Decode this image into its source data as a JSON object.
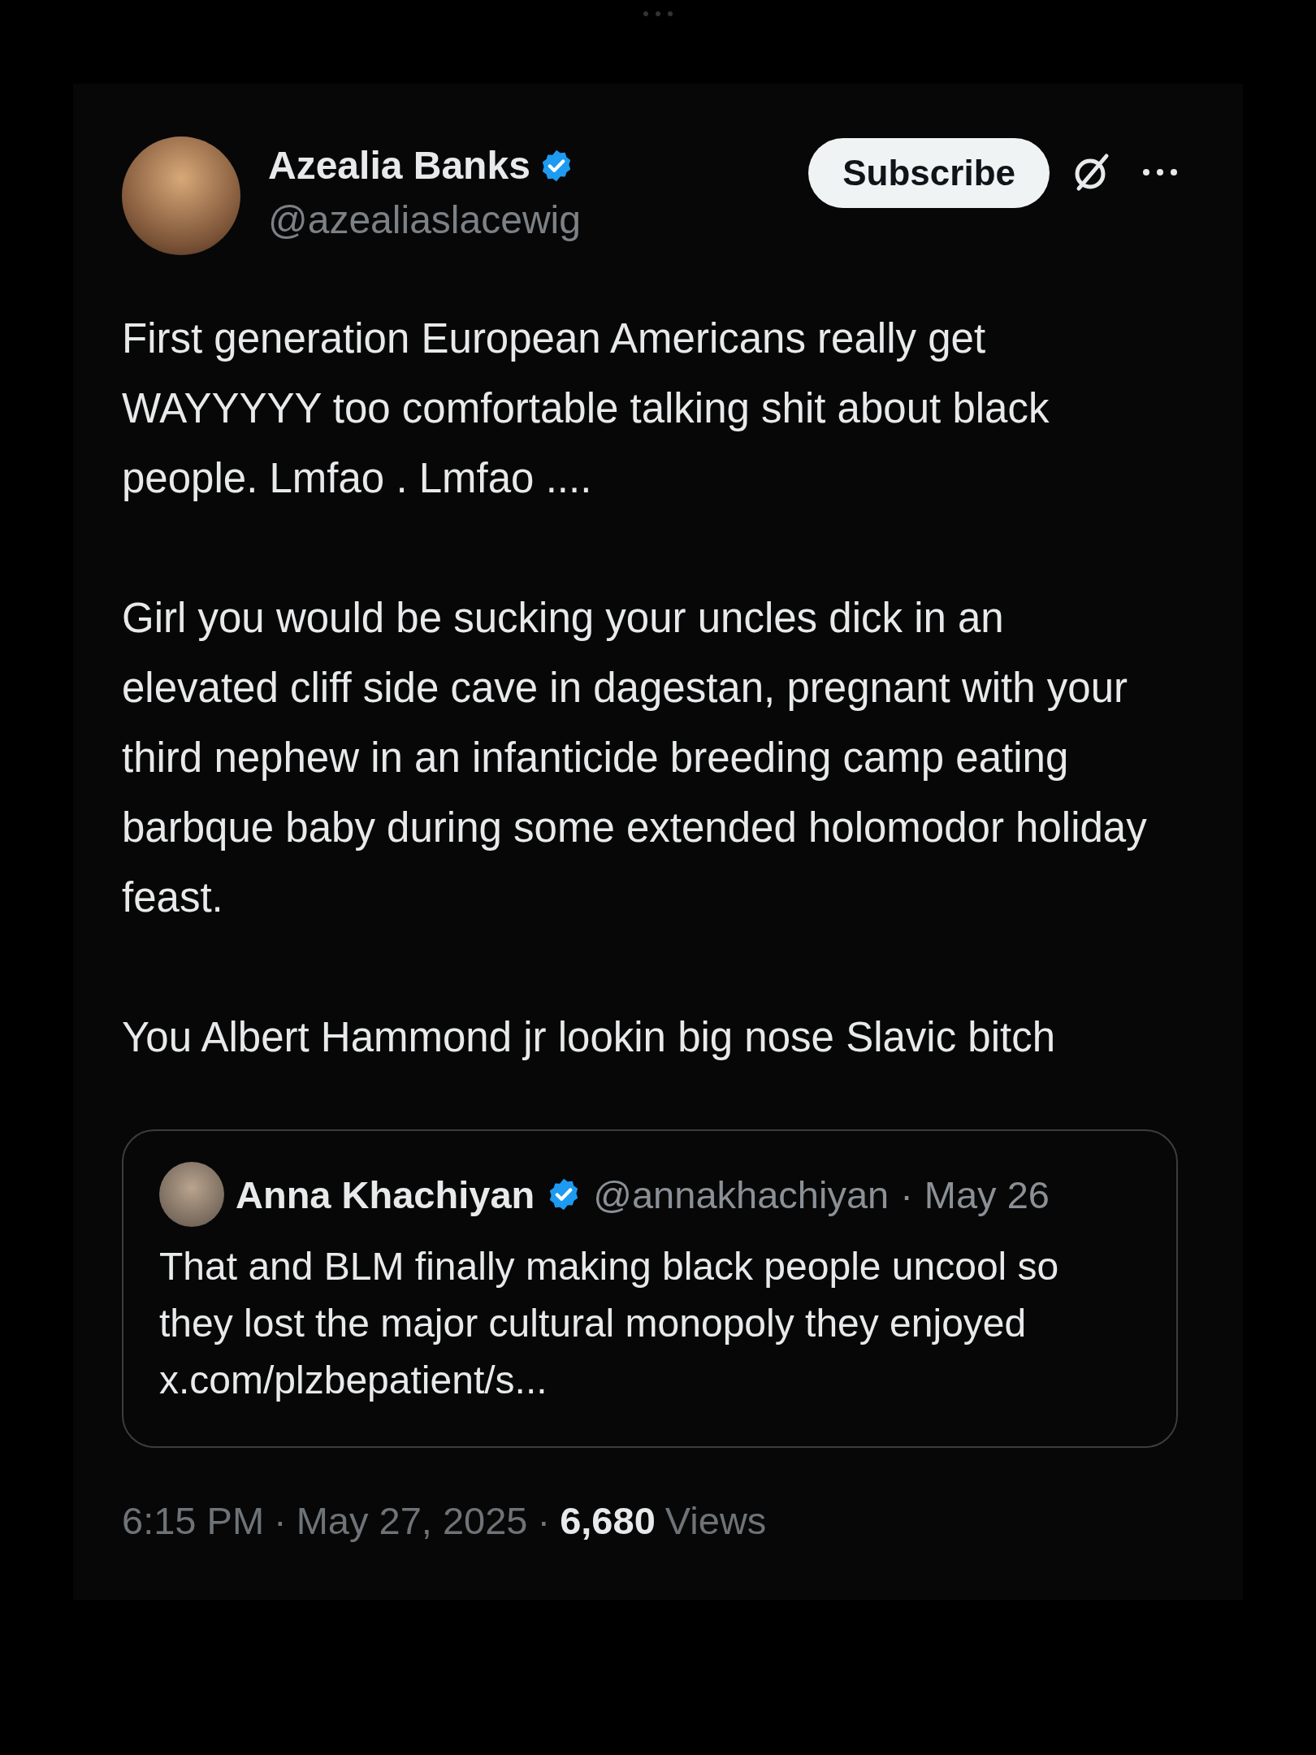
{
  "author": {
    "name": "Azealia Banks",
    "verified": true,
    "handle": "@azealiaslacewig"
  },
  "subscribe_button": "Subscribe",
  "paragraphs": [
    "First generation European Americans really get WAYYYYY too comfortable talking shit about black people. Lmfao . Lmfao ....",
    "Girl you would be sucking your uncles dick in an elevated cliff side cave in dagestan, pregnant with your third nephew in an infanticide breeding camp eating barbque baby during some extended holomodor holiday feast.",
    "You Albert Hammond jr lookin big nose Slavic bitch"
  ],
  "quote": {
    "name": "Anna Khachiyan",
    "verified": true,
    "handle": "@annakhachiyan",
    "separator": "·",
    "date": "May 26",
    "text": "That and BLM finally making black people uncool so they lost the major cultural monopoly they enjoyed x.com/plzbepatient/s..."
  },
  "footer": {
    "time": "6:15 PM",
    "separator_1": "·",
    "date": "May 27, 2025",
    "separator_2": "·",
    "views_count": "6,680",
    "views_label": "Views"
  }
}
